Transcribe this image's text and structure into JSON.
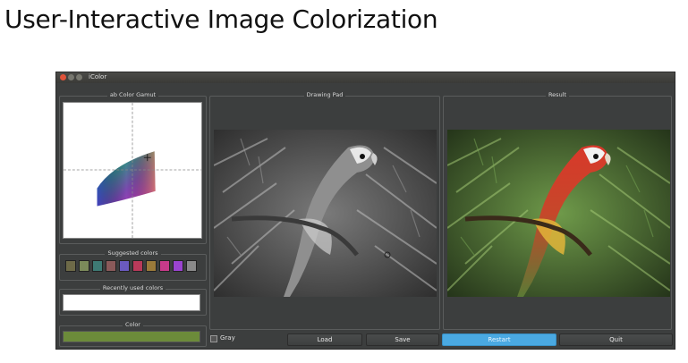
{
  "slide": {
    "title": "User-Interactive Image Colorization"
  },
  "window": {
    "title": "iColor",
    "panels": {
      "gamut": "ab Color Gamut",
      "suggested": "Suggested colors",
      "recent": "Recently used colors",
      "color": "Color",
      "drawing_pad": "Drawing Pad",
      "result": "Result"
    },
    "suggested_colors": [
      "#6e6a48",
      "#7b8a5a",
      "#3e7a74",
      "#8a5a5a",
      "#6a5ac0",
      "#b83a5a",
      "#9a7a3a",
      "#c83a8a",
      "#9a44cf",
      "#8a8a8a"
    ],
    "current_color": "#6c8b3a",
    "gray_checkbox_label": "Gray",
    "buttons": {
      "load": "Load",
      "save": "Save",
      "restart": "Restart",
      "quit": "Quit"
    },
    "accent": "#4aa9e2"
  }
}
